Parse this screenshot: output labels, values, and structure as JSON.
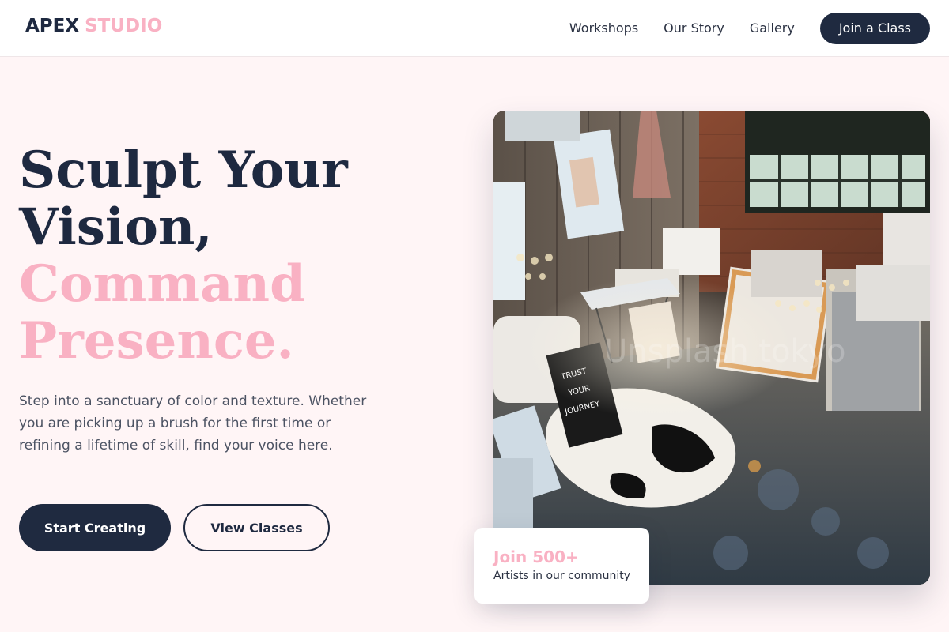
{
  "brand": {
    "primary": "APEX",
    "secondary": "STUDIO"
  },
  "nav": {
    "links": [
      "Workshops",
      "Our Story",
      "Gallery"
    ],
    "cta": "Join a Class"
  },
  "hero": {
    "headline": [
      "Sculpt Your",
      "Vision,",
      "Command",
      "Presence."
    ],
    "lead": "Step into a sanctuary of color and texture. Whether you are picking up a brush for the first time or refining a lifetime of skill, find your voice here.",
    "primary_button": "Start Creating",
    "secondary_button": "View Classes"
  },
  "image": {
    "description_icon": "art-studio-photo",
    "sign_text": [
      "TRUST",
      "YOUR",
      "JOURNEY"
    ],
    "watermark": "Unsplash tokyo"
  },
  "stat": {
    "number": "Join 500+",
    "label": "Artists in our community"
  },
  "colors": {
    "navy": "#1e2940",
    "pink": "#f9b1c3",
    "background": "#fff5f6",
    "text_muted": "#4c5363"
  }
}
